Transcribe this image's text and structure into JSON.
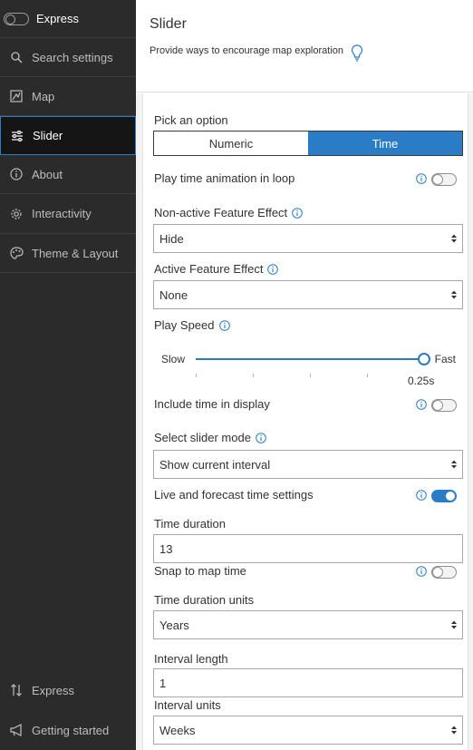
{
  "sidebar": {
    "mode_label": "Express",
    "items": [
      {
        "label": "Search settings",
        "icon": "search-icon"
      },
      {
        "label": "Map",
        "icon": "map-icon"
      },
      {
        "label": "Slider",
        "icon": "slider-icon",
        "active": true
      },
      {
        "label": "About",
        "icon": "info-icon"
      },
      {
        "label": "Interactivity",
        "icon": "gear-icon"
      },
      {
        "label": "Theme & Layout",
        "icon": "palette-icon"
      }
    ],
    "bottom": [
      {
        "label": "Express",
        "icon": "sort-arrows-icon"
      },
      {
        "label": "Getting started",
        "icon": "megaphone-icon"
      }
    ]
  },
  "header": {
    "title": "Slider",
    "subtitle": "Provide ways to encourage map exploration"
  },
  "form": {
    "pick_option_label": "Pick an option",
    "options": [
      "Numeric",
      "Time"
    ],
    "selected_option": "Time",
    "loop_label": "Play time animation in loop",
    "loop_on": false,
    "nonactive_label": "Non-active Feature Effect",
    "nonactive_value": "Hide",
    "active_label": "Active Feature Effect",
    "active_value": "None",
    "speed_label": "Play Speed",
    "speed_slow": "Slow",
    "speed_fast": "Fast",
    "speed_value": "0.25s",
    "speed_position": 1.0,
    "include_time_label": "Include time in display",
    "include_time_on": false,
    "slider_mode_label": "Select slider mode",
    "slider_mode_value": "Show current interval",
    "live_label": "Live and forecast time settings",
    "live_on": true,
    "duration_label": "Time duration",
    "duration_value": "13",
    "snap_label": "Snap to map time",
    "snap_on": false,
    "duration_units_label": "Time duration units",
    "duration_units_value": "Years",
    "interval_length_label": "Interval length",
    "interval_length_value": "1",
    "interval_units_label": "Interval units",
    "interval_units_value": "Weeks"
  },
  "colors": {
    "accent": "#2a7cc7",
    "sidebar_bg": "#2b2b2b"
  }
}
